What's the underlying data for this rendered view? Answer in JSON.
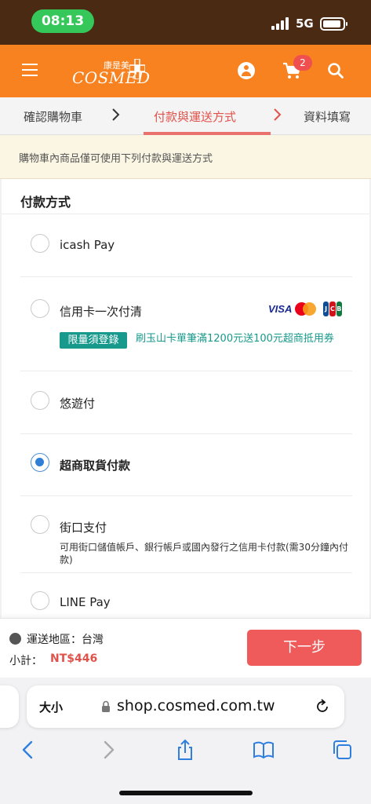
{
  "status_bar": {
    "time": "08:13",
    "network": "5G"
  },
  "header": {
    "logo_cn": "康是美",
    "logo_en": "COSMED",
    "cart_count": "2",
    "brand_color": "#f7821f"
  },
  "steps": [
    {
      "label": "確認購物車"
    },
    {
      "label": "付款與運送方式"
    },
    {
      "label": "資料填寫"
    }
  ],
  "notice": "購物車內商品僅可使用下列付款與運送方式",
  "payment": {
    "title": "付款方式",
    "options": [
      {
        "label": "icash Pay",
        "checked": false
      },
      {
        "label": "信用卡一次付清",
        "checked": false,
        "promo_badge": "限量須登錄",
        "promo_text": "刷玉山卡單筆滿1200元送100元超商抵用券",
        "card_logos": [
          "VISA",
          "Mastercard",
          "JCB"
        ]
      },
      {
        "label": "悠遊付",
        "checked": false
      },
      {
        "label": "超商取貨付款",
        "checked": true
      },
      {
        "label": "街口支付",
        "checked": false,
        "description": "可用街口儲值帳戶、銀行帳戶或國內發行之信用卡付款(需30分鐘內付款)"
      },
      {
        "label": "LINE Pay",
        "checked": false
      }
    ]
  },
  "summary": {
    "region": "運送地區：台灣",
    "subtotal_label": "小計：",
    "subtotal_value": "NT$446",
    "next_button": "下一步"
  },
  "browser": {
    "text_size_label": "大小",
    "url": "shop.cosmed.com.tw"
  }
}
